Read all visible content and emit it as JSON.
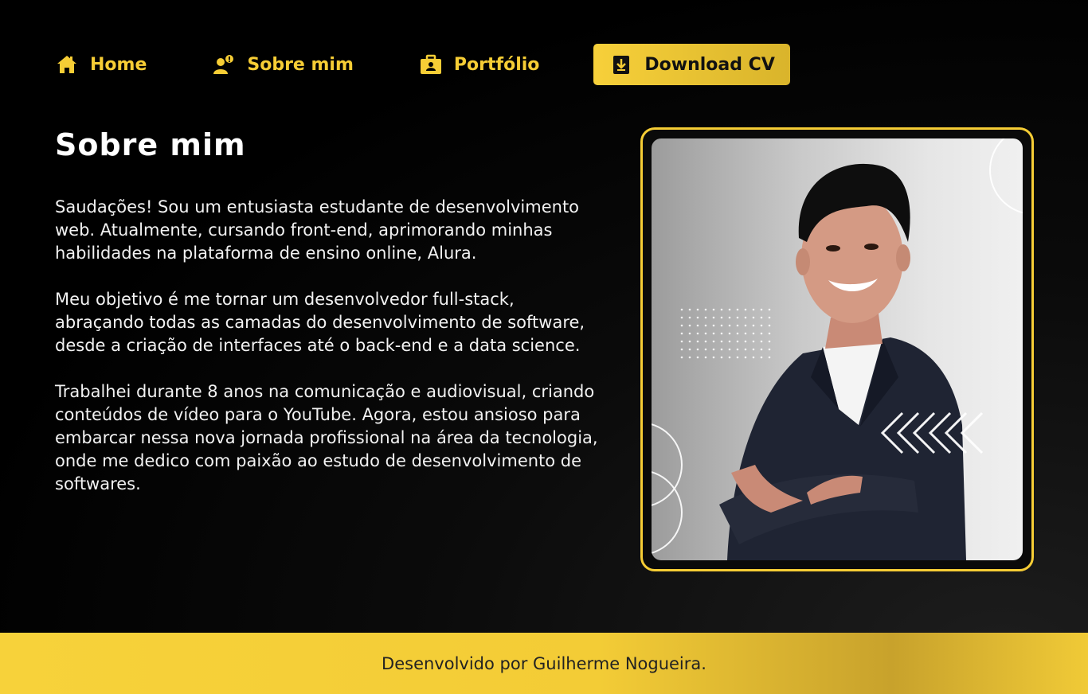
{
  "nav": {
    "items": [
      {
        "label": "Home",
        "icon": "home-icon"
      },
      {
        "label": "Sobre mim",
        "icon": "user-info-icon"
      },
      {
        "label": "Portfólio",
        "icon": "briefcase-icon"
      }
    ],
    "download": {
      "label": "Download CV",
      "icon": "download-icon"
    }
  },
  "main": {
    "title": "Sobre mim",
    "paragraphs": [
      "Saudações! Sou um entusiasta estudante de desenvolvimento web. Atualmente, cursando front-end, aprimorando minhas habilidades na plataforma de ensino online, Alura.",
      "Meu objetivo é me tornar um desenvolvedor full-stack, abraçando todas as camadas do desenvolvimento de software, desde a criação de interfaces até o back-end e a data science.",
      "Trabalhei durante 8 anos na comunicação e audiovisual, criando conteúdos de vídeo para o YouTube. Agora, estou ansioso para embarcar nessa nova jornada profissional na área da tecnologia, onde me dedico com paixão ao estudo de desenvolvimento de softwares."
    ]
  },
  "footer": {
    "text": "Desenvolvido por Guilherme Nogueira."
  },
  "colors": {
    "accent": "#f6cd35",
    "background": "#000000",
    "footer": "#f7d23a"
  }
}
